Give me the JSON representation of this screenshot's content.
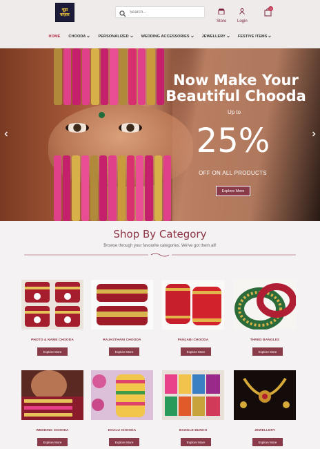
{
  "brand": {
    "logo_line1": "चूड़ा",
    "logo_line2": "बाज़ार"
  },
  "search": {
    "placeholder": "Search..."
  },
  "header": {
    "store_label": "Store",
    "login_label": "Login",
    "cart_count": "0",
    "store_icon": "store-icon",
    "login_icon": "user-icon",
    "cart_icon": "cart-icon"
  },
  "nav": {
    "items": [
      {
        "label": "HOME",
        "active": true,
        "dropdown": false
      },
      {
        "label": "CHOODA",
        "dropdown": true
      },
      {
        "label": "PERSONALIZED",
        "dropdown": true
      },
      {
        "label": "WEDDING ACCESSORIES",
        "dropdown": true
      },
      {
        "label": "JEWELLERY",
        "dropdown": true
      },
      {
        "label": "FESTIVE ITEMS",
        "dropdown": true
      }
    ]
  },
  "hero": {
    "title_line1": "Now Make Your",
    "title_line2": "Beautiful Chooda",
    "upto": "Up to",
    "percent": "25%",
    "offer": "OFF ON ALL PRODUCTS",
    "button": "Explore More"
  },
  "categories": {
    "title": "Shop By Category",
    "subtitle": "Browse through your favourite categories. We've got them all!",
    "button_label": "Explore More",
    "items": [
      {
        "label": "PHOTO & NAME CHOODA"
      },
      {
        "label": "RAJASTHANI CHOODA"
      },
      {
        "label": "PANJABI CHOODA"
      },
      {
        "label": "THRED BANGLES"
      },
      {
        "label": "WEDDING CHOODA"
      },
      {
        "label": "DHALU CHOODA"
      },
      {
        "label": "BANGLE BUNCH"
      },
      {
        "label": "JEWELLERY"
      }
    ]
  },
  "colors": {
    "accent": "#8c3344",
    "button": "#8a3b4a",
    "nav_active": "#b12d45",
    "header_bg": "#efebea",
    "page_bg": "#f4f2f2"
  }
}
